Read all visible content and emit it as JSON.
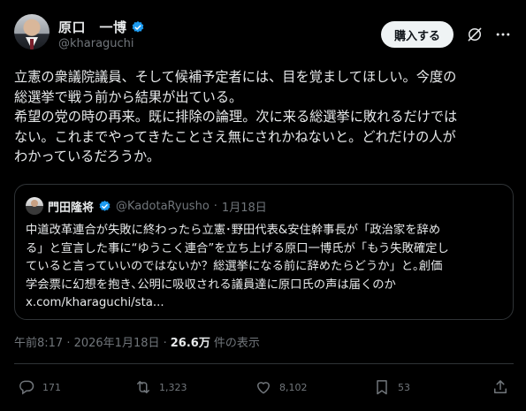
{
  "author": {
    "name": "原口　一博",
    "handle": "@kharaguchi"
  },
  "header": {
    "subscribe_label": "購入する"
  },
  "post": {
    "lines": [
      "立憲の衆議院議員、そして候補予定者には、目を覚ましてほしい。今度の",
      "総選挙で戦う前から結果が出ている。",
      "希望の党の時の再来。既に排除の論理。次に来る総選挙に敗れるだけでは",
      "ない。これまでやってきたことさえ無にされかねないと。どれだけの人が",
      "わかっているだろうか。"
    ]
  },
  "quote": {
    "name": "門田隆将",
    "handle": "@KadotaRyusho",
    "dot": "·",
    "date": "1月18日",
    "lines": [
      "中道改革連合が失敗に終わったら立憲･野田代表&安住幹事長が「政治家を辞め",
      "る」と宣言した事に“ゆうこく連合”を立ち上げる原口一博氏が「もう失敗確定し",
      "ていると言っていいのではないか？総選挙になる前に辞めたらどうか」と｡創価",
      "学会票に幻想を抱き､公明に吸収される議員達に原口氏の声は届くのか",
      "x.com/kharaguchi/sta..."
    ]
  },
  "meta": {
    "timestamp": "午前8:17 · 2026年1月18日 ·",
    "views": "26.6万",
    "views_suffix": "件の表示"
  },
  "actions": {
    "replies": "171",
    "reposts": "1,323",
    "likes": "8,102",
    "bookmarks": "53"
  },
  "colors": {
    "background": "#000000",
    "text": "#e7e9ea",
    "muted": "#71767b",
    "verified": "#1d9bf0",
    "border": "#2f3336"
  },
  "icons": [
    "verified-badge-icon",
    "grok-icon",
    "more-icon",
    "reply-icon",
    "repost-icon",
    "like-icon",
    "bookmark-icon",
    "share-icon"
  ]
}
